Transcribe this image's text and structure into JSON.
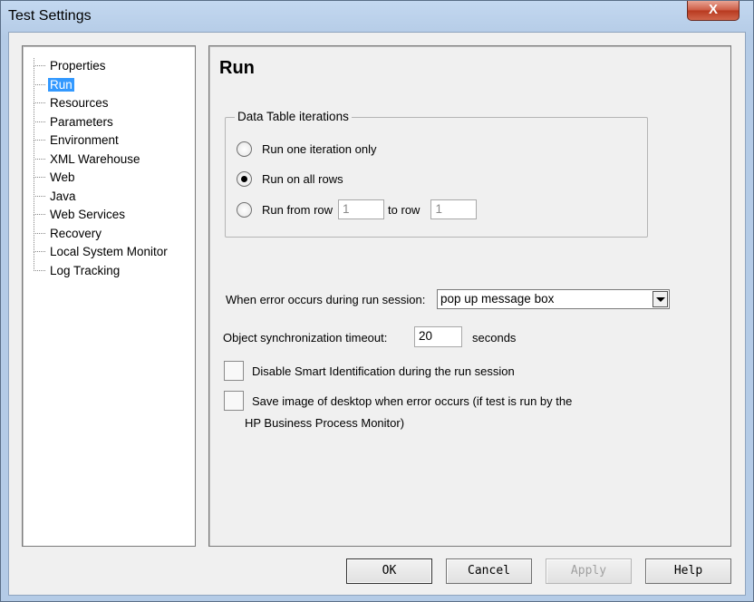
{
  "window": {
    "title": "Test Settings",
    "close_label": "X"
  },
  "sidebar": {
    "items": [
      {
        "label": "Properties",
        "selected": false
      },
      {
        "label": "Run",
        "selected": true
      },
      {
        "label": "Resources",
        "selected": false
      },
      {
        "label": "Parameters",
        "selected": false
      },
      {
        "label": "Environment",
        "selected": false
      },
      {
        "label": "XML Warehouse",
        "selected": false
      },
      {
        "label": "Web",
        "selected": false
      },
      {
        "label": "Java",
        "selected": false
      },
      {
        "label": "Web Services",
        "selected": false
      },
      {
        "label": "Recovery",
        "selected": false
      },
      {
        "label": "Local System Monitor",
        "selected": false
      },
      {
        "label": "Log Tracking",
        "selected": false
      }
    ]
  },
  "main": {
    "title": "Run",
    "iterations": {
      "legend": "Data Table iterations",
      "option_one": "Run one iteration only",
      "option_all": "Run on all rows",
      "option_range": "Run from row",
      "to_row_label": "to row",
      "from_value": "1",
      "to_value": "1",
      "selected": "all"
    },
    "error_label": "When error occurs during run session:",
    "error_value": "pop up message box",
    "sync_label": "Object synchronization timeout:",
    "sync_value": "20",
    "sync_unit": "seconds",
    "disable_smart_id": "Disable Smart Identification during the run session",
    "save_image_line1": "Save image of desktop when error occurs (if test is run by the",
    "save_image_line2": "HP Business Process Monitor)"
  },
  "buttons": {
    "ok": "OK",
    "cancel": "Cancel",
    "apply": "Apply",
    "help": "Help"
  },
  "colors": {
    "selection": "#3399ff",
    "close_button": "#c84b31"
  }
}
